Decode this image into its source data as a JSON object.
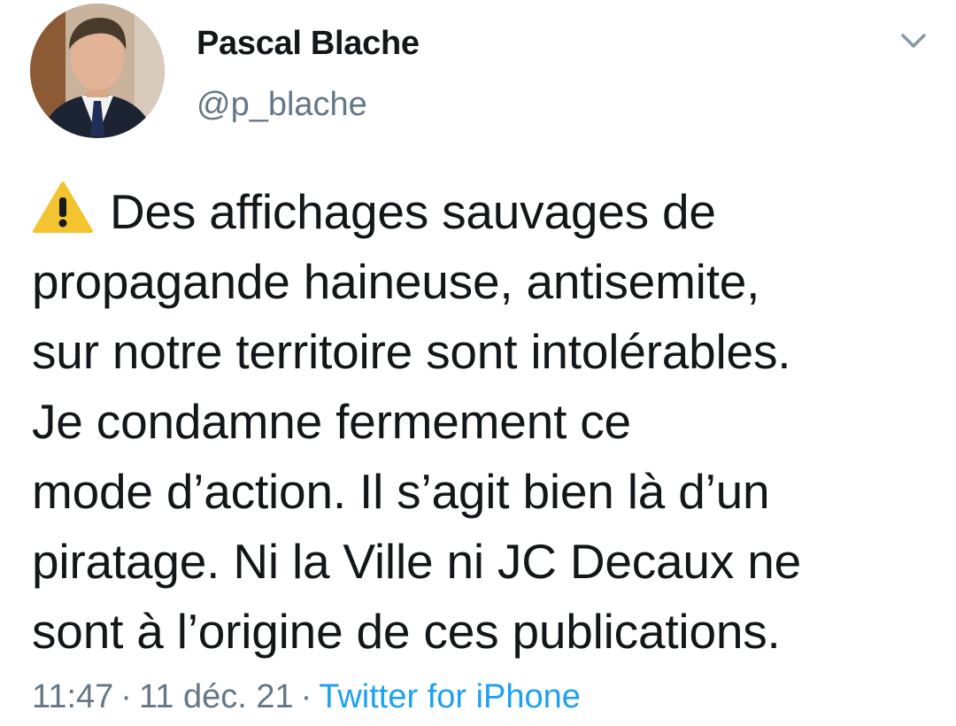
{
  "author": {
    "display_name": "Pascal Blache",
    "handle": "@p_blache"
  },
  "tweet": {
    "lines": [
      "Des affichages sauvages de",
      "propagande haineuse, antisemite,",
      "sur notre territoire sont intolérables.",
      "Je condamne fermement ce",
      "mode d’action. Il s’agit bien là d’un",
      "piratage. Ni la Ville ni JC Decaux ne",
      "sont à l’origine de ces publications."
    ],
    "time": "11:47",
    "separator": "·",
    "date": "11 déc. 21",
    "source": "Twitter for iPhone"
  },
  "icons": {
    "options": "chevron-down-icon",
    "warning": "warning-icon"
  },
  "colors": {
    "text": "#14171a",
    "secondary": "#657786",
    "link": "#1da1f2",
    "warning": "#f4c430"
  }
}
